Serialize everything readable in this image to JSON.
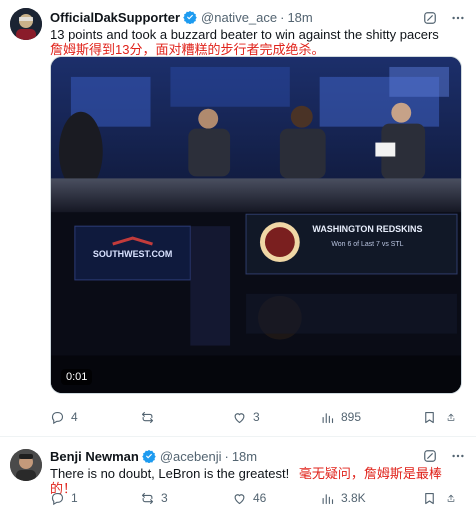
{
  "tweets": [
    {
      "name": "OfficialDakSupporter",
      "handle": "@native_ace",
      "dot": "·",
      "time": "18m",
      "text": "13 points and took a buzzard beater to win against the shitty pacers",
      "translation": "詹姆斯得到13分，面对糟糕的步行者完成绝杀。",
      "video": {
        "duration": "0:01",
        "scene_text": [
          "SOUTHWEST.COM",
          "WASHINGTON REDSKINS",
          "Won 6 of Last 7 vs STL"
        ]
      },
      "stats": {
        "replies": "4",
        "reposts": "",
        "likes": "3",
        "views": "895"
      }
    },
    {
      "name": "Benji Newman",
      "handle": "@acebenji",
      "dot": "·",
      "time": "18m",
      "text": "There is no doubt, LeBron is the greatest!",
      "translation": "毫无疑问，詹姆斯是最棒的！",
      "stats": {
        "replies": "1",
        "reposts": "3",
        "likes": "46",
        "views": "3.8K"
      }
    }
  ],
  "icons": {
    "verified": "verified-badge-icon",
    "grok": "grok-icon",
    "more": "more-icon",
    "reply": "reply-icon",
    "repost": "repost-icon",
    "like": "like-icon",
    "views": "views-icon",
    "bookmark": "bookmark-icon",
    "share": "share-icon"
  },
  "colors": {
    "verified": "#1d9bf0",
    "translation": "#e0231b",
    "secondary": "#536471"
  }
}
